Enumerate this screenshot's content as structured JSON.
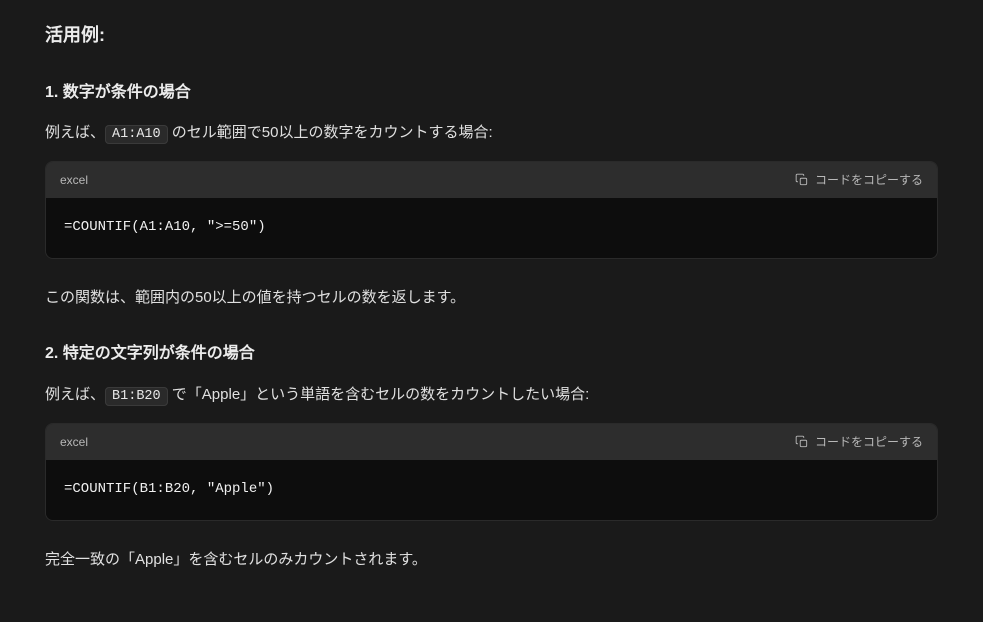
{
  "heading_main": "活用例:",
  "sections": [
    {
      "title": "1. 数字が条件の場合",
      "intro_prefix": "例えば、",
      "intro_code": "A1:A10",
      "intro_suffix": " のセル範囲で50以上の数字をカウントする場合:",
      "code_lang": "excel",
      "copy_label": "コードをコピーする",
      "code_content": "=COUNTIF(A1:A10, \">=50\")",
      "outro": "この関数は、範囲内の50以上の値を持つセルの数を返します。"
    },
    {
      "title": "2. 特定の文字列が条件の場合",
      "intro_prefix": "例えば、",
      "intro_code": "B1:B20",
      "intro_suffix": " で「Apple」という単語を含むセルの数をカウントしたい場合:",
      "code_lang": "excel",
      "copy_label": "コードをコピーする",
      "code_content": "=COUNTIF(B1:B20, \"Apple\")",
      "outro": "完全一致の「Apple」を含むセルのみカウントされます。"
    }
  ]
}
